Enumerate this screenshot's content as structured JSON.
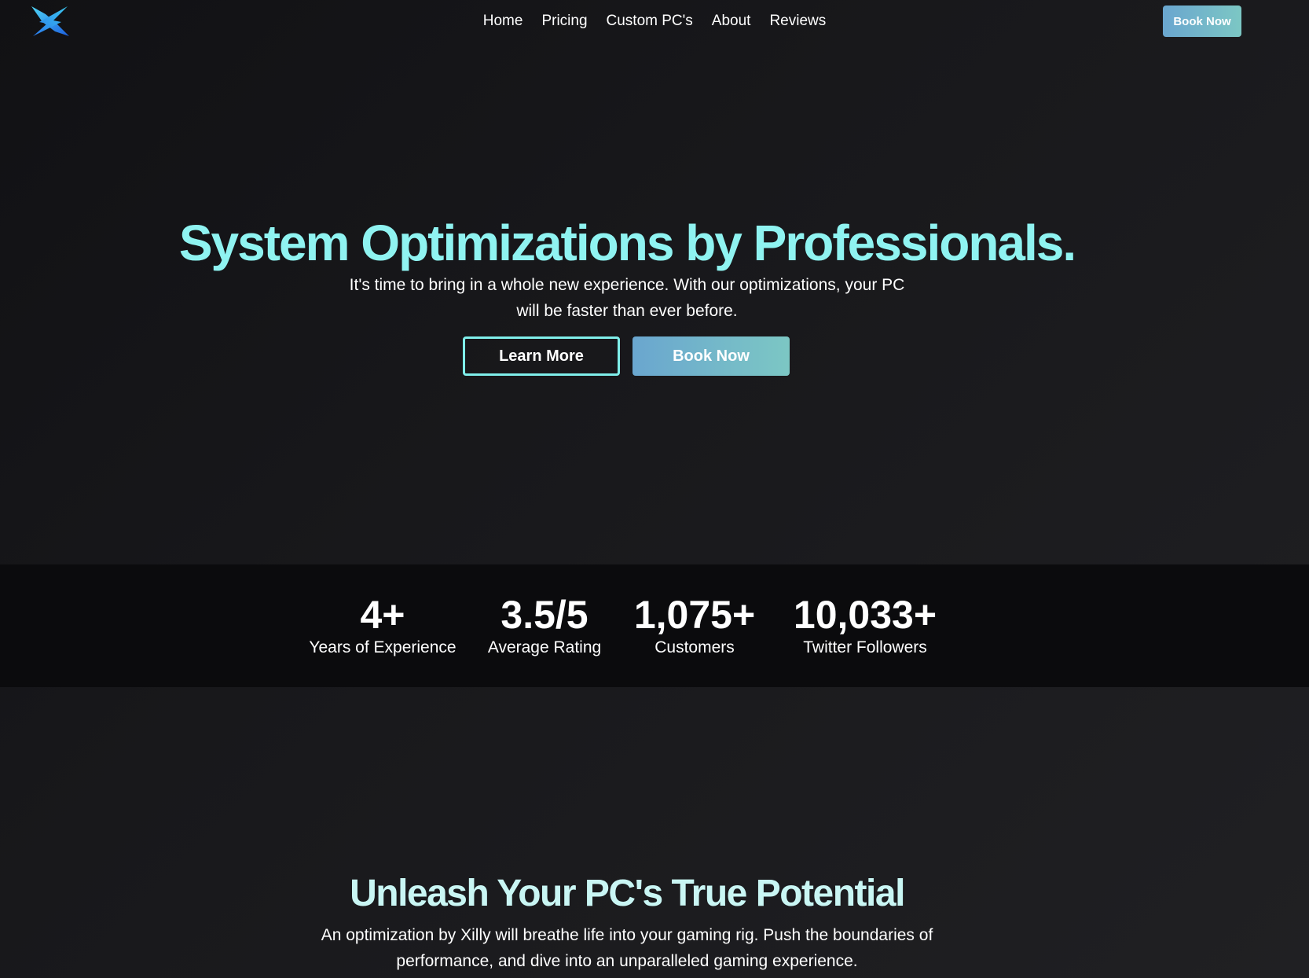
{
  "nav": {
    "logo": "xilly-logo",
    "links": [
      "Home",
      "Pricing",
      "Custom PC's",
      "About",
      "Reviews"
    ],
    "cta_label": "Book Now"
  },
  "hero": {
    "title": "System Optimizations by Professionals.",
    "subtitle": "It's time to bring in a whole new experience. With our optimizations, your PC will be faster than ever before.",
    "learn_more_label": "Learn More",
    "book_now_label": "Book Now"
  },
  "stats": [
    {
      "value": "4+",
      "label": "Years of Experience"
    },
    {
      "value": "3.5/5",
      "label": "Average Rating"
    },
    {
      "value": "1,075+",
      "label": "Customers"
    },
    {
      "value": "10,033+",
      "label": "Twitter Followers"
    }
  ],
  "section": {
    "title": "Unleash Your PC's True Potential",
    "subtitle": "An optimization by Xilly will breathe life into your gaming rig. Push the boundaries of performance, and dive into an unparalleled gaming experience."
  },
  "colors": {
    "accent": "#8ff3f1",
    "button_gradient_start": "#6aa6cf",
    "button_gradient_end": "#7cc7c4",
    "background": "#18181b",
    "stats_band": "#0b0b0d"
  }
}
